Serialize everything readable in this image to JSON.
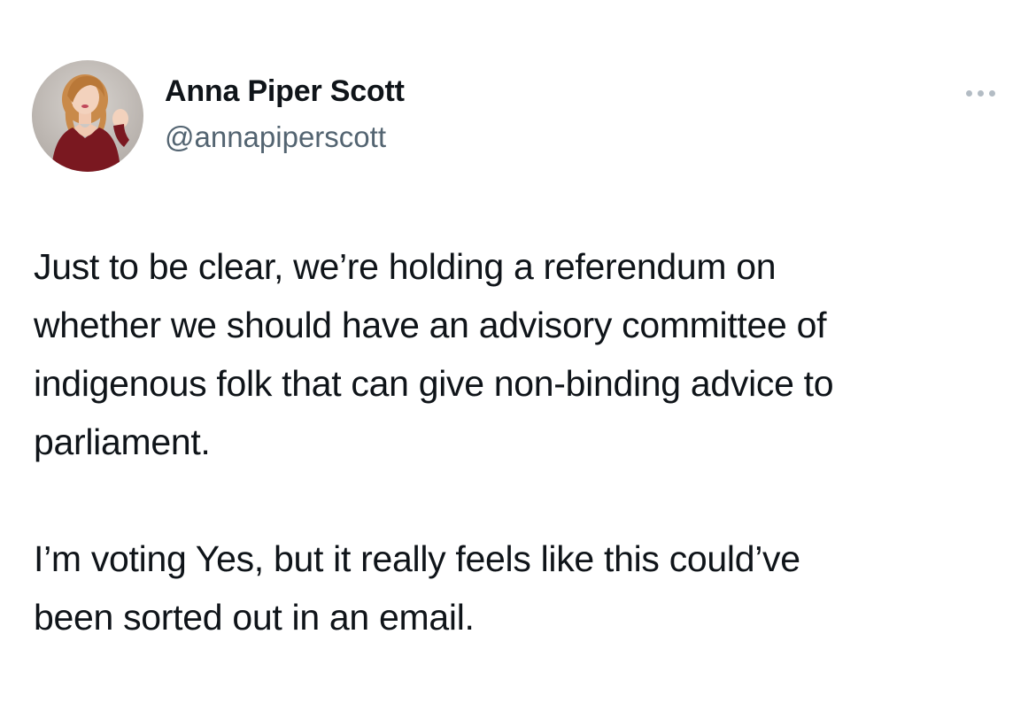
{
  "author": {
    "display_name": "Anna Piper Scott",
    "handle": "@annapiperscott",
    "avatar_icon": "profile-photo"
  },
  "menu": {
    "icon": "more-options-icon"
  },
  "tweet": {
    "paragraphs": [
      "Just to be clear, we’re holding a referendum on\nwhether we should have an advisory committee of\nindigenous folk that can give non-binding advice to\nparliament.",
      "I’m voting Yes, but it really feels like this could’ve\nbeen sorted out in an email."
    ]
  },
  "colors": {
    "text": "#0f1419",
    "secondary_text": "#536471",
    "menu_dots": "#b3bcc4",
    "avatar_dress": "#7a1820",
    "avatar_hair": "#c98a4a"
  }
}
